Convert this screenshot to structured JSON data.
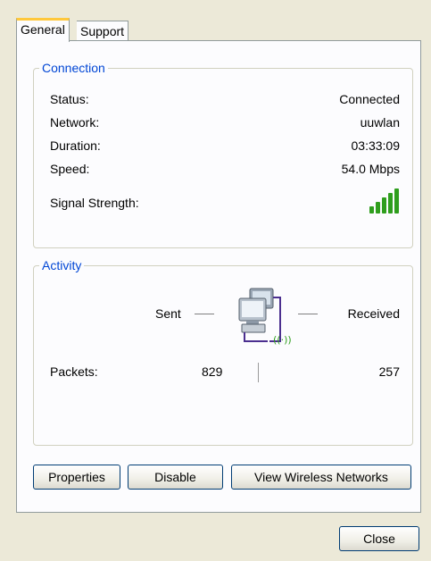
{
  "tabs": {
    "general": "General",
    "support": "Support"
  },
  "connection": {
    "legend": "Connection",
    "status_label": "Status:",
    "status_value": "Connected",
    "network_label": "Network:",
    "network_value": "uuwlan",
    "duration_label": "Duration:",
    "duration_value": "03:33:09",
    "speed_label": "Speed:",
    "speed_value": "54.0 Mbps",
    "signal_label": "Signal Strength:",
    "signal_bars": 5,
    "signal_icon": "signal-strength-icon"
  },
  "activity": {
    "legend": "Activity",
    "sent_label": "Sent",
    "received_label": "Received",
    "network_icon": "wireless-network-computers-icon",
    "packets_label": "Packets:",
    "packets_sent": "829",
    "packets_received": "257"
  },
  "buttons": {
    "properties": "Properties",
    "disable": "Disable",
    "view_networks": "View Wireless Networks",
    "close": "Close"
  },
  "colors": {
    "legend_text": "#0046d5",
    "tab_highlight": "#ffc83c",
    "signal_green": "#2f9e1d",
    "button_border": "#003c74"
  }
}
